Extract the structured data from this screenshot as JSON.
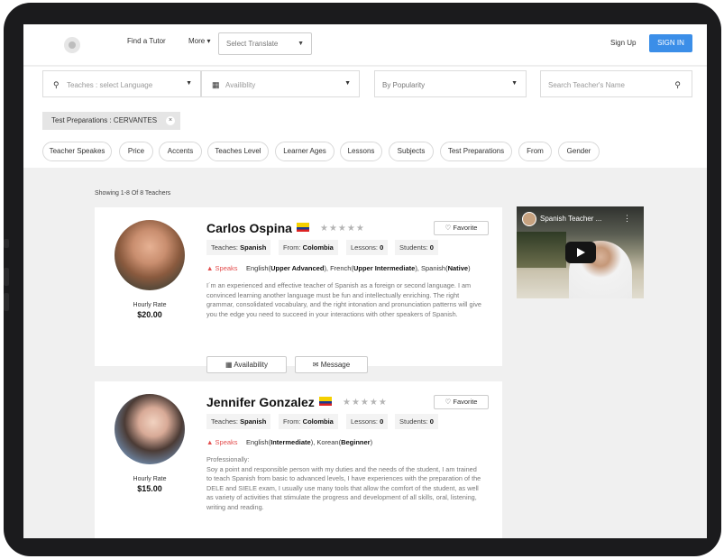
{
  "header": {
    "find_tutor": "Find a Tutor",
    "more": "More ▾",
    "translate_placeholder": "Select Translate",
    "sign_up": "Sign Up",
    "sign_in": "SIGN IN"
  },
  "filters": {
    "language_placeholder": "Teaches : select Language",
    "availability_placeholder": "Availiblity",
    "sort_value": "By Popularity",
    "search_placeholder": "Search Teacher's Name",
    "active_filter": "Test Preparations : CERVANTES",
    "pills": [
      "Teacher Speakes",
      "Price",
      "Accents",
      "Teaches Level",
      "Learner Ages",
      "Lessons",
      "Subjects",
      "Test Preparations",
      "From",
      "Gender"
    ]
  },
  "results": {
    "showing": "Showing 1-8 Of 8 Teachers",
    "favorite_label": "Favorite",
    "availability_label": "Availability",
    "message_label": "Message",
    "hourly_rate_label": "Hourly Rate",
    "speaks_label": "Speaks",
    "teachers": [
      {
        "name": "Carlos Ospina",
        "rating_stars": "★★★★★",
        "teaches_label": "Teaches: ",
        "teaches": "Spanish",
        "from_label": "From: ",
        "from": "Colombia",
        "lessons_label": "Lessons: ",
        "lessons": "0",
        "students_label": "Students: ",
        "students": "0",
        "languages": "English(Upper Advanced), French(Upper Intermediate), Spanish(Native)",
        "bio": "I´m an experienced and effective teacher of Spanish as a foreign or second language. I am convinced learning another language must be fun and intellectually enriching. The right grammar, consolidated vocabulary, and the right intonation and pronunciation patterns will give you the edge you need to succeed in your interactions with other speakers of Spanish.",
        "hourly_rate": "$20.00"
      },
      {
        "name": "Jennifer Gonzalez",
        "rating_stars": "★★★★★",
        "teaches_label": "Teaches: ",
        "teaches": "Spanish",
        "from_label": "From: ",
        "from": "Colombia",
        "lessons_label": "Lessons: ",
        "lessons": "0",
        "students_label": "Students: ",
        "students": "0",
        "languages": "English(Intermediate), Korean(Beginner)",
        "bio": "Professionally:\nSoy a point and responsible person with my duties and the needs of the student, I am trained to teach Spanish from basic to advanced levels, I have experiences with the preparation of the DELE and SIELE exam, I usually use many tools that allow the comfort of the student, as well as variety of activities that stimulate the progress and development of all skills, oral, listening, writing and reading.",
        "hourly_rate": "$15.00"
      }
    ]
  },
  "video": {
    "title": "Spanish Teacher ..."
  },
  "colors": {
    "accent": "#3b8ee8",
    "speaks": "#e34d4d",
    "frame": "#1b1b1d"
  }
}
